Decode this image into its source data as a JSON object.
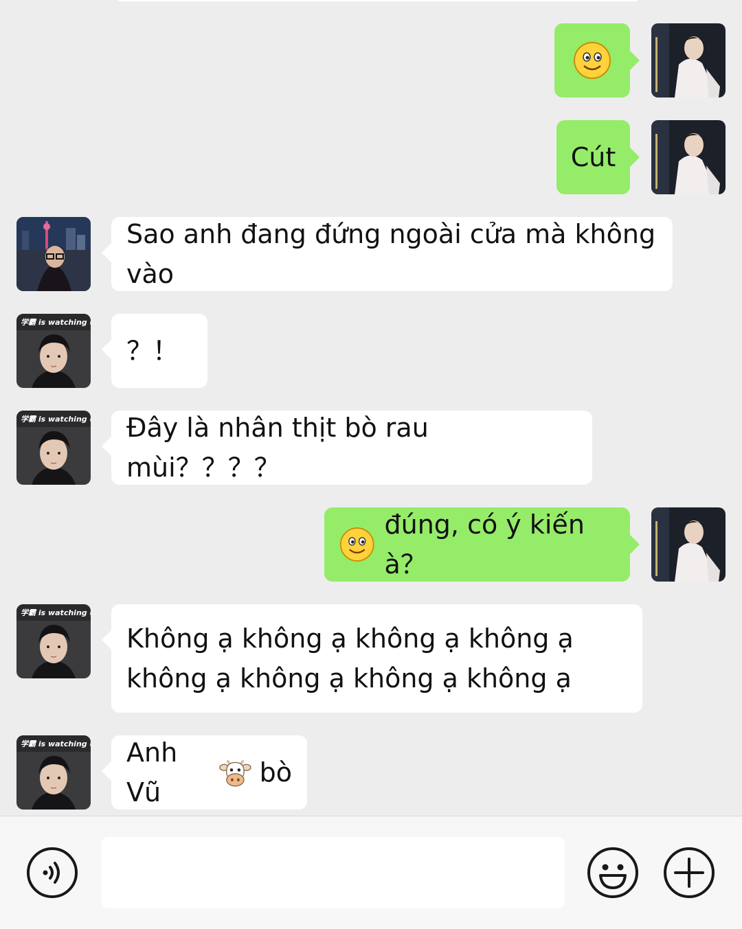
{
  "messages": [
    {
      "side": "out",
      "avatar": "self",
      "text": "",
      "emoji": "smile"
    },
    {
      "side": "out",
      "avatar": "self",
      "text": "Cút"
    },
    {
      "side": "in",
      "avatar": "city",
      "text": "Sao anh đang đứng ngoài cửa mà không vào"
    },
    {
      "side": "in",
      "avatar": "watching",
      "text": "？！"
    },
    {
      "side": "in",
      "avatar": "watching",
      "text": "Đây là nhân thịt bò rau mùi？？？？"
    },
    {
      "side": "out",
      "avatar": "self",
      "text": "đúng, có ý kiến à？",
      "emoji": "smile"
    },
    {
      "side": "in",
      "avatar": "watching",
      "text": "Không ạ không ạ không ạ không ạ không ạ không ạ không ạ không ạ"
    },
    {
      "side": "in",
      "avatar": "watching",
      "text_before": "Anh Vũ",
      "text_after": "bò",
      "emoji": "cow"
    }
  ],
  "avatar_badge_text": "学霸 is watching u",
  "input": {
    "value": "",
    "placeholder": ""
  },
  "icons": {
    "voice": "voice-icon",
    "emoji": "emoji-icon",
    "more": "plus-icon"
  },
  "colors": {
    "background": "#ededed",
    "incoming_bubble": "#ffffff",
    "outgoing_bubble": "#95ec69"
  }
}
